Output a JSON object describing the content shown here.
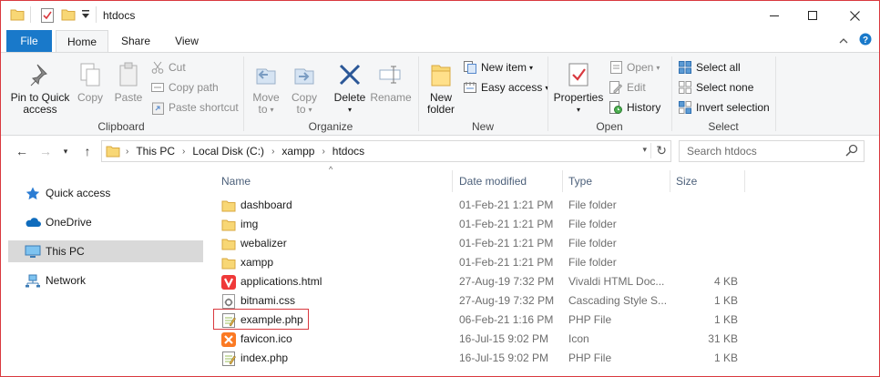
{
  "window": {
    "title": "htdocs",
    "controls": {
      "minimize": "—",
      "maximize": "☐",
      "close": "✕"
    }
  },
  "ribbon_tabs": [
    {
      "label": "File"
    },
    {
      "label": "Home"
    },
    {
      "label": "Share"
    },
    {
      "label": "View"
    }
  ],
  "ribbon": {
    "clipboard": {
      "label": "Clipboard",
      "pin_label_1": "Pin to Quick",
      "pin_label_2": "access",
      "copy": "Copy",
      "paste": "Paste",
      "cut": "Cut",
      "copy_path": "Copy path",
      "paste_shortcut": "Paste shortcut"
    },
    "organize": {
      "label": "Organize",
      "move_to_1": "Move",
      "move_to_2": "to",
      "copy_to_1": "Copy",
      "copy_to_2": "to",
      "delete": "Delete",
      "rename": "Rename"
    },
    "new": {
      "label": "New",
      "new_folder_1": "New",
      "new_folder_2": "folder",
      "new_item": "New item",
      "easy_access": "Easy access"
    },
    "open": {
      "label": "Open",
      "properties": "Properties",
      "open": "Open",
      "edit": "Edit",
      "history": "History"
    },
    "select": {
      "label": "Select",
      "select_all": "Select all",
      "select_none": "Select none",
      "invert_selection": "Invert selection"
    }
  },
  "address": {
    "breadcrumbs": [
      "This PC",
      "Local Disk (C:)",
      "xampp",
      "htdocs"
    ],
    "search_placeholder": "Search htdocs"
  },
  "nav_pane": [
    {
      "label": "Quick access",
      "icon": "star-icon"
    },
    {
      "label": "OneDrive",
      "icon": "cloud-icon"
    },
    {
      "label": "This PC",
      "icon": "computer-icon",
      "selected": true
    },
    {
      "label": "Network",
      "icon": "network-icon"
    }
  ],
  "columns": {
    "name": "Name",
    "date": "Date modified",
    "type": "Type",
    "size": "Size"
  },
  "files": [
    {
      "name": "dashboard",
      "date": "01-Feb-21 1:21 PM",
      "type": "File folder",
      "size": "",
      "icon": "folder"
    },
    {
      "name": "img",
      "date": "01-Feb-21 1:21 PM",
      "type": "File folder",
      "size": "",
      "icon": "folder"
    },
    {
      "name": "webalizer",
      "date": "01-Feb-21 1:21 PM",
      "type": "File folder",
      "size": "",
      "icon": "folder"
    },
    {
      "name": "xampp",
      "date": "01-Feb-21 1:21 PM",
      "type": "File folder",
      "size": "",
      "icon": "folder"
    },
    {
      "name": "applications.html",
      "date": "27-Aug-19 7:32 PM",
      "type": "Vivaldi HTML Doc...",
      "size": "4 KB",
      "icon": "vivaldi"
    },
    {
      "name": "bitnami.css",
      "date": "27-Aug-19 7:32 PM",
      "type": "Cascading Style S...",
      "size": "1 KB",
      "icon": "css"
    },
    {
      "name": "example.php",
      "date": "06-Feb-21 1:16 PM",
      "type": "PHP File",
      "size": "1 KB",
      "icon": "php"
    },
    {
      "name": "favicon.ico",
      "date": "16-Jul-15 9:02 PM",
      "type": "Icon",
      "size": "31 KB",
      "icon": "xampp"
    },
    {
      "name": "index.php",
      "date": "16-Jul-15 9:02 PM",
      "type": "PHP File",
      "size": "1 KB",
      "icon": "php"
    }
  ],
  "colors": {
    "accent": "#1979ca",
    "highlight": "#d9393f",
    "folder": "#f8d775"
  }
}
